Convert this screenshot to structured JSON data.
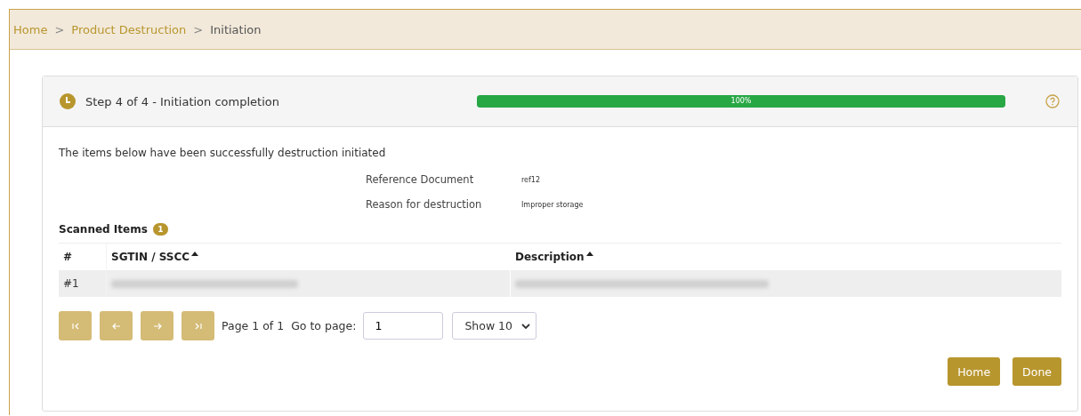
{
  "breadcrumb": [
    {
      "label": "Home",
      "link": true
    },
    {
      "label": "Product Destruction",
      "link": true
    },
    {
      "label": "Initiation",
      "link": false
    }
  ],
  "breadcrumb_separator": ">",
  "step": {
    "title": "Step 4 of 4 - Initiation completion",
    "level": 1.0,
    "reading": "100%"
  },
  "message": "The items below have been successfully destruction initiated",
  "details": [
    {
      "label": "Reference Document",
      "value": "ref12"
    },
    {
      "label": "Reason for destruction",
      "value": "Improper storage"
    }
  ],
  "scanned": {
    "title": "Scanned Items",
    "count": "1"
  },
  "table": {
    "columns": [
      {
        "label": "#",
        "sortable": false
      },
      {
        "label": "SGTIN / SSCC",
        "sortable": true
      },
      {
        "label": "Description",
        "sortable": true
      }
    ],
    "rows": [
      {
        "index": "#1"
      }
    ]
  },
  "pagination": {
    "info": "Page 1 of 1",
    "goto_label": "Go to page:",
    "goto_value": "1",
    "page_size": "Show 10"
  },
  "buttons": [
    "Home",
    "Done"
  ]
}
